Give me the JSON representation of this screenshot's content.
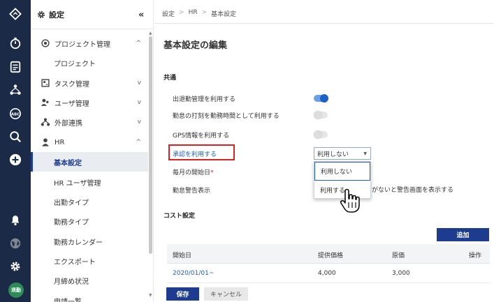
{
  "rail": {
    "icons": [
      "app-logo-icon",
      "stopwatch-icon",
      "document-icon",
      "org-chart-icon",
      "abc-icon",
      "search-icon",
      "add-icon",
      "bell-icon",
      "globe-icon",
      "gear-icon"
    ],
    "avatar_text": "退勤",
    "avatar_color": "#2e8b57"
  },
  "sidebar": {
    "title": "設定",
    "collapse_glyph": "«",
    "items": [
      {
        "label": "プロジェクト管理",
        "icon": "target-icon",
        "chevron": "^"
      },
      {
        "label": "プロジェクト"
      },
      {
        "label": "タスク管理",
        "icon": "task-icon",
        "chevron": "v"
      },
      {
        "label": "ユーザ管理",
        "icon": "users-icon",
        "chevron": "v"
      },
      {
        "label": "外部連携",
        "icon": "network-icon",
        "chevron": "v"
      },
      {
        "label": "HR",
        "icon": "person-icon",
        "chevron": "^"
      },
      {
        "label": "基本設定"
      },
      {
        "label": "HR ユーザ管理"
      },
      {
        "label": "出勤タイプ"
      },
      {
        "label": "勤務タイプ"
      },
      {
        "label": "勤務カレンダー"
      },
      {
        "label": "エクスポート"
      },
      {
        "label": "月締め状況"
      },
      {
        "label": "申請一覧"
      }
    ]
  },
  "breadcrumb": [
    "設定",
    "HR",
    "基本設定"
  ],
  "page_title": "基本設定の編集",
  "common": {
    "heading": "共通",
    "rows": [
      {
        "label": "出退勤管理を利用する",
        "toggle_on": true
      },
      {
        "label": "勤怠の打刻を勤務時間として利用する",
        "toggle_on": false
      },
      {
        "label": "GPS情報を利用する",
        "toggle_on": false
      },
      {
        "label": "承認を利用する"
      },
      {
        "label": "毎月の開始日",
        "required_mark": "*"
      },
      {
        "label": "勤怠警告表示"
      }
    ],
    "approval_select": {
      "selected": "利用しない",
      "options": [
        "利用しない",
        "利用する"
      ]
    },
    "warning_text": "がないと警告画面を表示する"
  },
  "cost": {
    "heading": "コスト設定",
    "add_label": "追加",
    "columns": [
      "開始日",
      "提供価格",
      "原価",
      "操作"
    ],
    "rows": [
      {
        "start": "2020/01/01~",
        "price": "4,000",
        "cost": "3,000",
        "op": ""
      }
    ]
  },
  "actions": {
    "save_label": "保存",
    "cancel_label": "キャンセル"
  },
  "colors": {
    "rail_bg": "#1b2a47",
    "primary": "#1d3b8f",
    "highlight_border": "#e02020",
    "link": "#1d5fb8"
  }
}
